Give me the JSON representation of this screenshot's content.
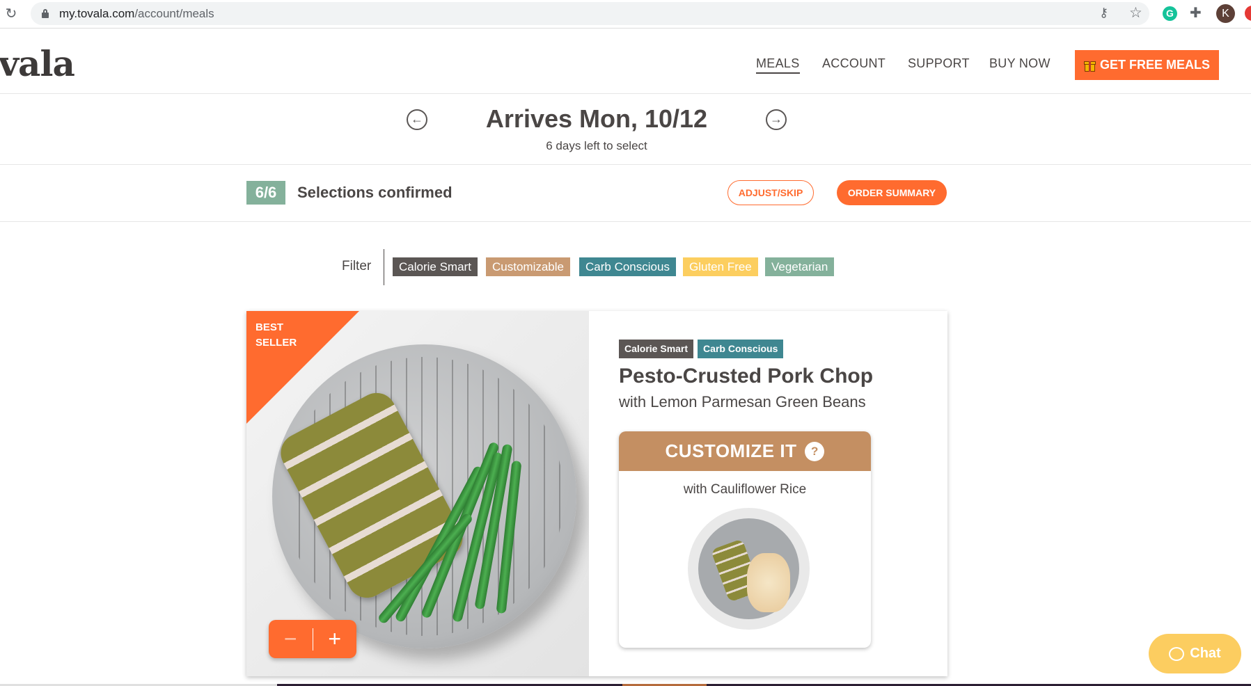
{
  "browser": {
    "url_host": "my.tovala.com",
    "url_path": "/account/meals",
    "profile_initial": "K",
    "extension_grammarly_letter": "G"
  },
  "header": {
    "logo": "vala",
    "nav": [
      {
        "label": "MEALS",
        "active": true
      },
      {
        "label": "ACCOUNT",
        "active": false
      },
      {
        "label": "SUPPORT",
        "active": false
      },
      {
        "label": "BUY NOW",
        "active": false
      }
    ],
    "cta_label": "GET FREE MEALS"
  },
  "delivery": {
    "title": "Arrives Mon, 10/12",
    "subtitle": "6 days left to select",
    "prev_icon": "arrow-left-circle",
    "next_icon": "arrow-right-circle"
  },
  "selections": {
    "count": "6/6",
    "status": "Selections confirmed",
    "adjust_label": "ADJUST/SKIP",
    "summary_label": "ORDER SUMMARY"
  },
  "filter": {
    "label": "Filter",
    "chips": [
      {
        "label": "Calorie Smart",
        "color": "#5b5654"
      },
      {
        "label": "Customizable",
        "color": "#c99a72"
      },
      {
        "label": "Carb Conscious",
        "color": "#3f8791"
      },
      {
        "label": "Gluten Free",
        "color": "#fcce5f"
      },
      {
        "label": "Vegetarian",
        "color": "#84b19b"
      }
    ]
  },
  "meal": {
    "ribbon": "BEST\nSELLER",
    "ribbon_line1": "BEST",
    "ribbon_line2": "SELLER",
    "tags": [
      {
        "label": "Calorie Smart",
        "color": "#5b5654"
      },
      {
        "label": "Carb Conscious",
        "color": "#3f8791"
      }
    ],
    "title": "Pesto-Crusted Pork Chop",
    "subtitle": "with Lemon Parmesan Green Beans",
    "quantity_minus": "−",
    "quantity_plus": "+",
    "customize": {
      "header": "CUSTOMIZE IT",
      "help": "?",
      "option": "with Cauliflower Rice"
    }
  },
  "chat": {
    "label": "Chat"
  },
  "colors": {
    "accent": "#ff6b2f",
    "text": "#4a4645",
    "confirmed": "#84b19b",
    "customize": "#c48f62",
    "chat": "#fccd60"
  }
}
